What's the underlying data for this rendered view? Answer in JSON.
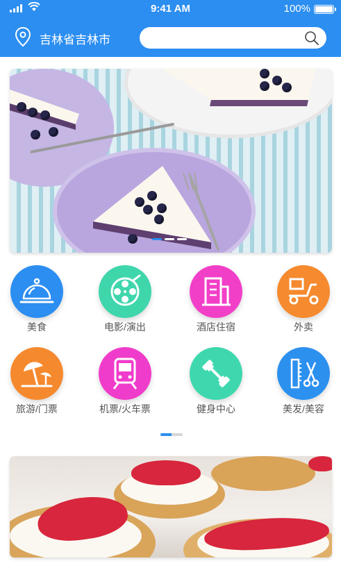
{
  "status_bar": {
    "time": "9:41 AM",
    "battery": "100%"
  },
  "header": {
    "location": "吉林省吉林市",
    "search_placeholder": ""
  },
  "banner_top": {
    "slide_count": 3,
    "active_index": 0
  },
  "categories": [
    {
      "label": "美食",
      "icon": "food-cloche-icon",
      "color": "#2c8ef0"
    },
    {
      "label": "电影/演出",
      "icon": "film-reel-icon",
      "color": "#3fd6ac"
    },
    {
      "label": "酒店住宿",
      "icon": "hotel-building-icon",
      "color": "#f23fc8"
    },
    {
      "label": "外卖",
      "icon": "scooter-icon",
      "color": "#f58a2f"
    },
    {
      "label": "旅游/门票",
      "icon": "beach-umbrella-icon",
      "color": "#f5892e"
    },
    {
      "label": "机票/火车票",
      "icon": "train-icon",
      "color": "#f03ccb"
    },
    {
      "label": "健身中心",
      "icon": "dumbbell-icon",
      "color": "#3fd8ae"
    },
    {
      "label": "美发/美容",
      "icon": "comb-scissors-icon",
      "color": "#2c90ef"
    }
  ],
  "category_pager": {
    "page_count": 2,
    "active_index": 0
  },
  "colors": {
    "primary": "#2c8ef0",
    "background": "#ffffff"
  }
}
